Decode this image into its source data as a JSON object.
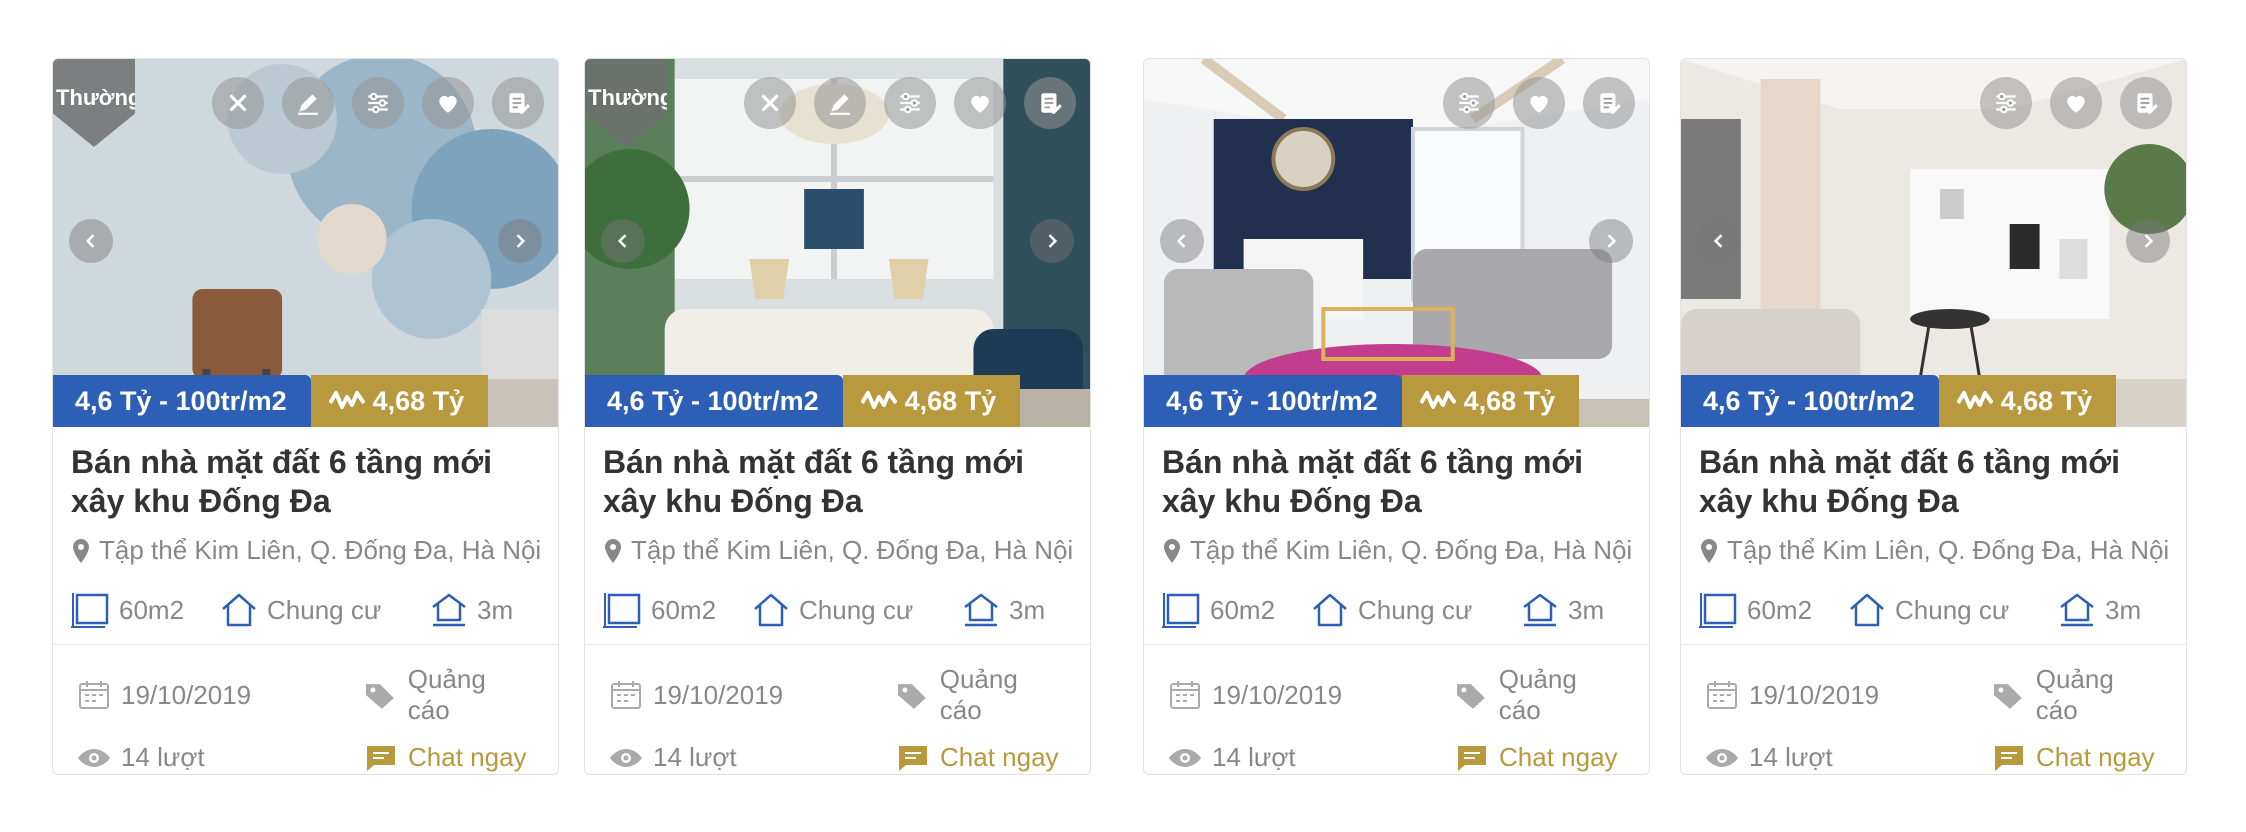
{
  "cards": [
    {
      "type_badge": "Thường",
      "price_main": "4,6 Tỷ - 100tr/m2",
      "price_total": "4,68 Tỷ",
      "title": "Bán nhà mặt đất 6 tầng mới xây khu Đống Đa",
      "address": "Tập thể Kim Liên, Q. Đống Đa, Hà Nội",
      "area": "60m2",
      "category": "Chung cư",
      "frontage": "3m",
      "date": "19/10/2019",
      "views": "14 lượt",
      "ad_label": "Quảng cáo",
      "chat_label": "Chat ngay"
    },
    {
      "type_badge": "Thường",
      "price_main": "4,6 Tỷ - 100tr/m2",
      "price_total": "4,68 Tỷ",
      "title": "Bán nhà mặt đất 6 tầng mới xây khu Đống Đa",
      "address": "Tập thể Kim Liên, Q. Đống Đa, Hà Nội",
      "area": "60m2",
      "category": "Chung cư",
      "frontage": "3m",
      "date": "19/10/2019",
      "views": "14 lượt",
      "ad_label": "Quảng cáo",
      "chat_label": "Chat ngay"
    },
    {
      "price_main": "4,6 Tỷ - 100tr/m2",
      "price_total": "4,68 Tỷ",
      "title": "Bán nhà mặt đất 6 tầng mới xây khu Đống Đa",
      "address": "Tập thể Kim Liên, Q. Đống Đa, Hà Nội",
      "area": "60m2",
      "category": "Chung cư",
      "frontage": "3m",
      "date": "19/10/2019",
      "views": "14 lượt",
      "ad_label": "Quảng cáo",
      "chat_label": "Chat ngay"
    },
    {
      "price_main": "4,6 Tỷ - 100tr/m2",
      "price_total": "4,68 Tỷ",
      "title": "Bán nhà mặt đất 6 tầng mới xây khu Đống Đa",
      "address": "Tập thể Kim Liên, Q. Đống Đa, Hà Nội",
      "area": "60m2",
      "category": "Chung cư",
      "frontage": "3m",
      "date": "19/10/2019",
      "views": "14 lượt",
      "ad_label": "Quảng cáo",
      "chat_label": "Chat ngay"
    }
  ],
  "colors": {
    "price_blue": "#2d5fb6",
    "price_gold": "#b8993d",
    "text_dark": "#333333",
    "text_muted": "#888888",
    "icon_blue": "#2d5fb6"
  },
  "icons": [
    "close-icon",
    "edit-icon",
    "sliders-icon",
    "heart-icon",
    "note-icon",
    "chevron-left-icon",
    "chevron-right-icon",
    "pulse-icon",
    "location-pin-icon",
    "area-icon",
    "house-icon",
    "frontage-icon",
    "calendar-icon",
    "tag-icon",
    "eye-icon",
    "chat-icon"
  ]
}
